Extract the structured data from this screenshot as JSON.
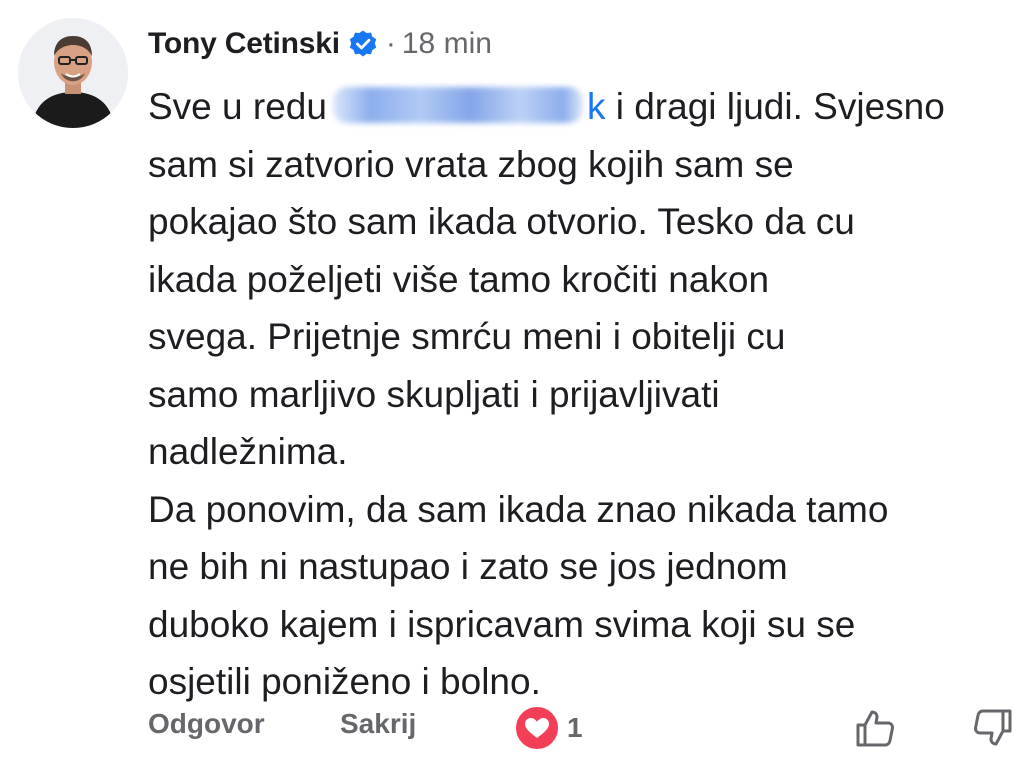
{
  "comment": {
    "author": "Tony Cetinski",
    "dot": "·",
    "time": "18 min",
    "line1_before": "Sve u redu",
    "line1_redacted_tail": "k",
    "line1_after": "i dragi ljudi. Svjesno",
    "lines": [
      "sam si zatvorio vrata zbog kojih sam se",
      "pokajao što sam ikada otvorio. Tesko da cu",
      "ikada poželjeti više tamo kročiti nakon",
      "svega. Prijetnje smrću meni i obitelji cu",
      "samo marljivo skupljati i prijavljivati",
      "nadležnima.",
      "Da ponovim, da sam ikada znao nikada tamo",
      "ne bih ni nastupao i zato se jos jednom",
      "duboko kajem i ispricavam svima koji su se",
      "osjetili poniženo i bolno."
    ]
  },
  "actions": {
    "reply_label": "Odgovor",
    "hide_label": "Sakrij",
    "reaction_count": "1"
  },
  "icons": {
    "verified": "verified-badge-icon",
    "reaction": "heart-reaction-icon",
    "like": "thumbs-up-icon",
    "dislike": "thumbs-down-icon"
  },
  "colors": {
    "verified_blue": "#1877f2",
    "heart_red": "#f33e58",
    "muted_text": "#65676b",
    "body_text": "#1c1e21"
  }
}
